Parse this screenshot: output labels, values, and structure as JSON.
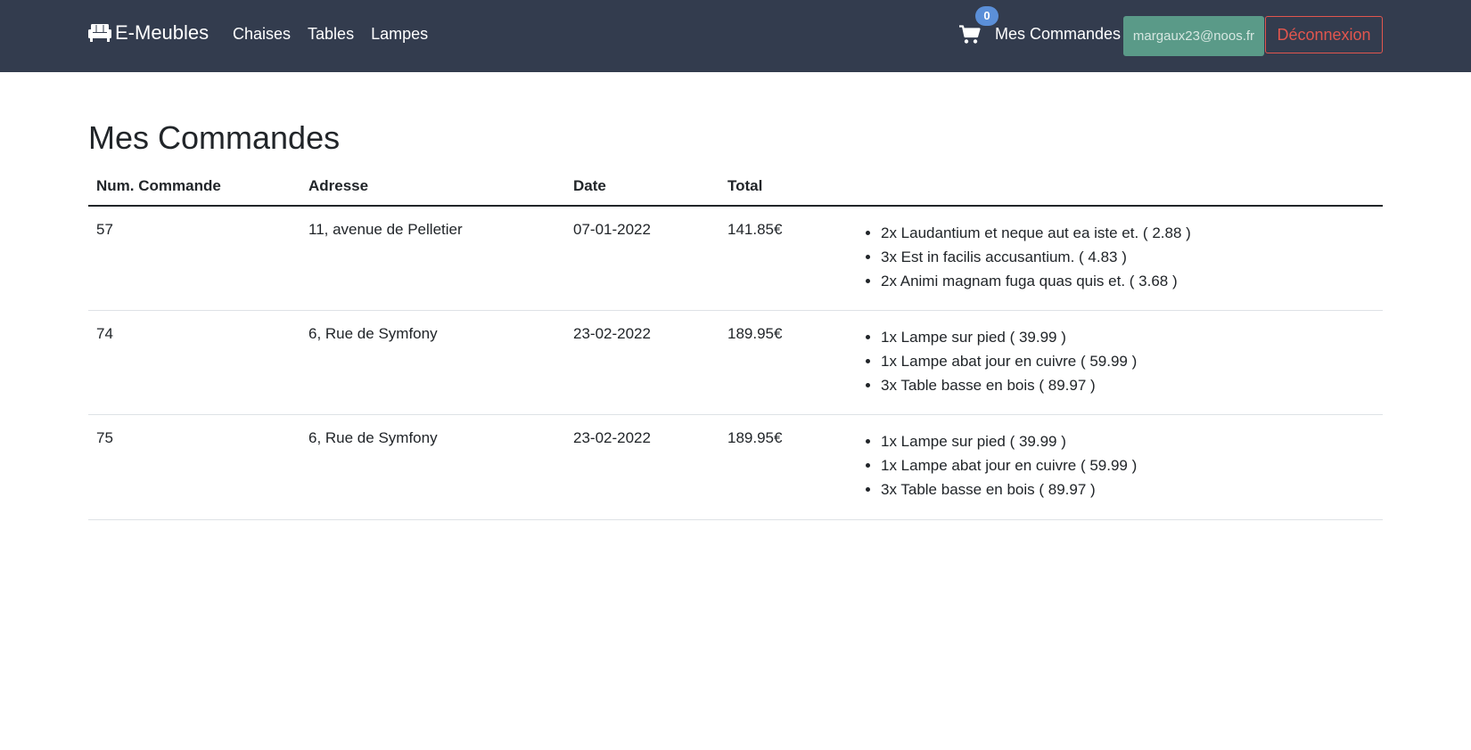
{
  "navbar": {
    "brand": "E-Meubles",
    "links": [
      "Chaises",
      "Tables",
      "Lampes"
    ],
    "cart_count": "0",
    "orders_label": "Mes Commandes",
    "user_email": "margaux23@noos.fr",
    "logout_label": "Déconnexion"
  },
  "page": {
    "title": "Mes Commandes"
  },
  "table": {
    "headers": [
      "Num. Commande",
      "Adresse",
      "Date",
      "Total",
      ""
    ],
    "rows": [
      {
        "num": "57",
        "address": "11, avenue de Pelletier",
        "date": "07-01-2022",
        "total": "141.85€",
        "items": [
          "2x Laudantium et neque aut ea iste et. ( 2.88 )",
          "3x Est in facilis accusantium. ( 4.83 )",
          "2x Animi magnam fuga quas quis et. ( 3.68 )"
        ]
      },
      {
        "num": "74",
        "address": "6, Rue de Symfony",
        "date": "23-02-2022",
        "total": "189.95€",
        "items": [
          "1x Lampe sur pied ( 39.99 )",
          "1x Lampe abat jour en cuivre ( 59.99 )",
          "3x Table basse en bois ( 89.97 )"
        ]
      },
      {
        "num": "75",
        "address": "6, Rue de Symfony",
        "date": "23-02-2022",
        "total": "189.95€",
        "items": [
          "1x Lampe sur pied ( 39.99 )",
          "1x Lampe abat jour en cuivre ( 59.99 )",
          "3x Table basse en bois ( 89.97 )"
        ]
      }
    ]
  },
  "icons": {
    "brand": "couch-icon",
    "cart": "shopping-cart-icon"
  },
  "colors": {
    "navbar_bg": "#333c4e",
    "badge": "#5b8fd8",
    "user_btn": "#5a9a88",
    "logout": "#e2564e"
  }
}
